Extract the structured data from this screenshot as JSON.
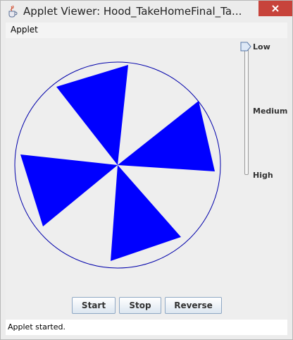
{
  "window": {
    "title": "Applet Viewer: Hood_TakeHomeFinal_Ta..."
  },
  "menu": {
    "applet_label": "Applet"
  },
  "wheel": {
    "ring_color": "#0000aa",
    "blade_color": "#0000ff",
    "blade_count": 4
  },
  "speed_slider": {
    "low_label": "Low",
    "medium_label": "Medium",
    "high_label": "High",
    "selected": "Low"
  },
  "buttons": {
    "start_label": "Start",
    "stop_label": "Stop",
    "reverse_label": "Reverse"
  },
  "status": {
    "text": "Applet started."
  },
  "icons": {
    "app": "java-cup-icon",
    "close": "close-icon"
  }
}
